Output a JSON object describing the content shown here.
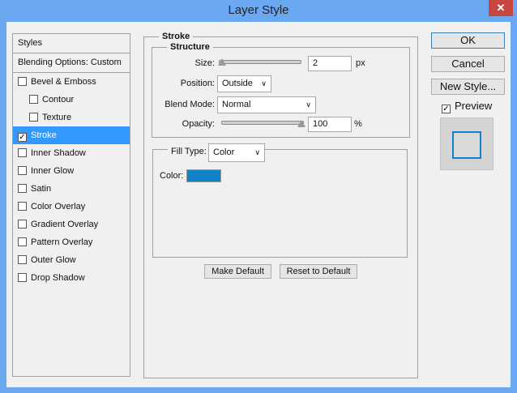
{
  "window": {
    "title": "Layer Style",
    "close": "✕"
  },
  "styles_list": {
    "header": "Styles",
    "blending": "Blending Options: Custom",
    "items": [
      {
        "label": "Bevel & Emboss",
        "checked": false,
        "indent": false
      },
      {
        "label": "Contour",
        "checked": false,
        "indent": true
      },
      {
        "label": "Texture",
        "checked": false,
        "indent": true
      },
      {
        "label": "Stroke",
        "checked": true,
        "indent": false,
        "selected": true
      },
      {
        "label": "Inner Shadow",
        "checked": false,
        "indent": false
      },
      {
        "label": "Inner Glow",
        "checked": false,
        "indent": false
      },
      {
        "label": "Satin",
        "checked": false,
        "indent": false
      },
      {
        "label": "Color Overlay",
        "checked": false,
        "indent": false
      },
      {
        "label": "Gradient Overlay",
        "checked": false,
        "indent": false
      },
      {
        "label": "Pattern Overlay",
        "checked": false,
        "indent": false
      },
      {
        "label": "Outer Glow",
        "checked": false,
        "indent": false
      },
      {
        "label": "Drop Shadow",
        "checked": false,
        "indent": false
      }
    ]
  },
  "stroke": {
    "title": "Stroke",
    "structure": "Structure",
    "size_label": "Size:",
    "size_value": "2",
    "size_unit": "px",
    "position_label": "Position:",
    "position_value": "Outside",
    "blend_label": "Blend Mode:",
    "blend_value": "Normal",
    "opacity_label": "Opacity:",
    "opacity_value": "100",
    "opacity_unit": "%",
    "fill_type_label": "Fill Type:",
    "fill_type_value": "Color",
    "color_label": "Color:",
    "color": "#1083c8",
    "make_default": "Make Default",
    "reset_default": "Reset to Default"
  },
  "actions": {
    "ok": "OK",
    "cancel": "Cancel",
    "new_style": "New Style...",
    "preview": "Preview",
    "preview_checked": true
  },
  "colors": {
    "accent": "#3399ff",
    "title_bar": "#6aa8f2",
    "close": "#c7463f"
  }
}
